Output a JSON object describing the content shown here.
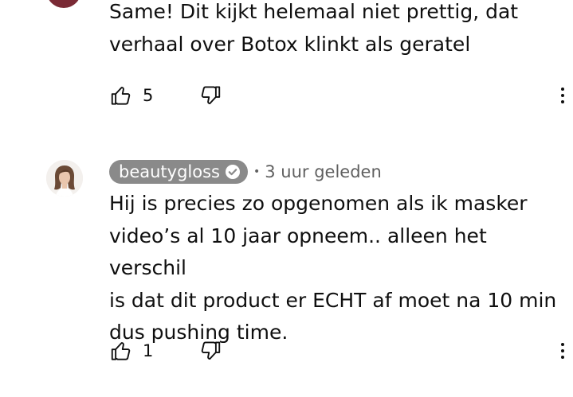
{
  "comments": [
    {
      "text": "Same! Dit kijkt helemaal niet prettig, dat\nverhaal over Botox klinkt als geratel",
      "likes": "5"
    },
    {
      "channel": "beautygloss",
      "separator": "•",
      "time": "3 uur geleden",
      "text": "Hij is precies zo opgenomen als ik masker\nvideo’s al 10 jaar opneem.. alleen het verschil\nis dat dit product er ECHT af moet na 10 min\ndus pushing time.",
      "likes": "1"
    }
  ],
  "icons": {
    "like": "thumb-up-outline",
    "dislike": "thumb-down-outline",
    "more": "vertical-ellipsis",
    "verified": "check-circle"
  },
  "colors": {
    "text": "#0f0f0f",
    "secondary": "#606060",
    "badge": "#8a8a8a"
  }
}
